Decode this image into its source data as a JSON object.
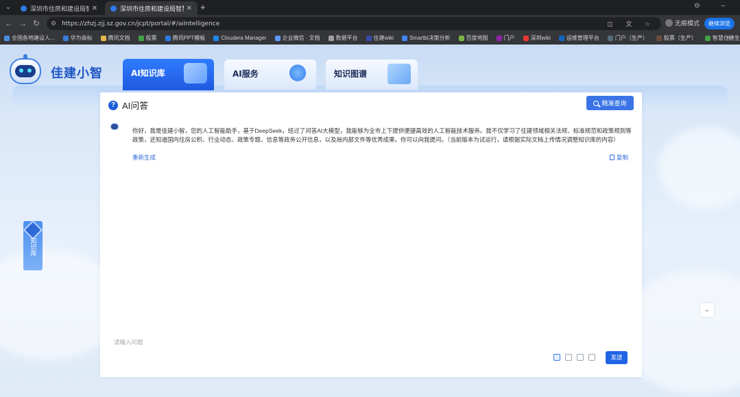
{
  "browser": {
    "tabs": [
      {
        "title": "深圳市住房和建设局智慧住建...",
        "active": false
      },
      {
        "title": "深圳市住房和建设局智慧住建...",
        "active": true
      }
    ],
    "url": "https://zhzj.zjj.sz.gov.cn/jcpt/portal/#/aiIntelligence",
    "profile_label": "无痕模式",
    "resume_label": "继续浏览",
    "bookmarks": [
      "全国各地建设人...",
      "华为商标",
      "腾讯文档",
      "股票",
      "腾讯PPT模板",
      "Cloudera Manager",
      "企业微信 · 文档",
      "数据平台",
      "住建wiki",
      "Smartbi决策分析",
      "百度地图",
      "门户",
      "深圳wiki",
      "运维管理平台",
      "门户（生产）",
      "股票（生产）",
      "智慧住建生产环境..."
    ]
  },
  "header": {
    "brand": "佳建小智",
    "nav_tabs": [
      {
        "label": "AI知识库",
        "active": true
      },
      {
        "label": "AI服务",
        "active": false
      },
      {
        "label": "知识图谱",
        "active": false
      }
    ]
  },
  "side": {
    "kb_label": "知识库"
  },
  "card": {
    "title": "AI问答",
    "search_button": "精准查询",
    "message": "你好，我是佳建小智，您的人工智能助手，基于DeepSeek，经过了问答AI大模型，我能够为全市上下提供便捷高效的人工智能技术服务。我不仅学习了住建领域相关法规、标准规范和政策规则等政策，还知道国内住房公积、行业动态、政策专题、信息等政务公开信息，以及局内部文件等优秀成果。你可以向我提问。（当前版本为试运行，请根据实际文档上传情况调整知识库的内容）",
    "regenerate": "重新生成",
    "copy": "复制",
    "input_placeholder": "请输入问题",
    "send": "发送"
  },
  "colors": {
    "accent": "#1f65e3",
    "brand": "#1f55c4",
    "link": "#2f6ad9"
  }
}
